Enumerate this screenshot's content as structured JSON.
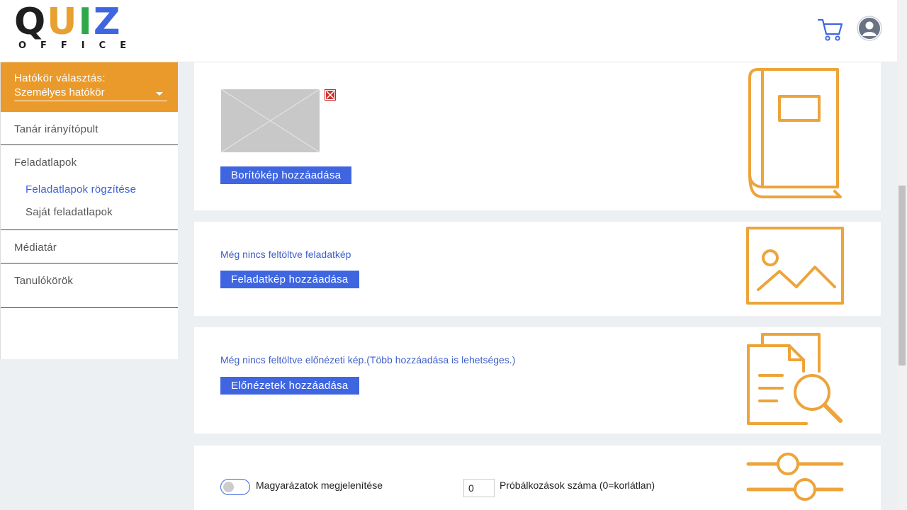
{
  "logo": {
    "line1": "QUIZ",
    "line2": "OFFICE"
  },
  "header": {
    "cart_icon": "cart-icon",
    "avatar_icon": "user-avatar-icon"
  },
  "sidebar": {
    "scope_label": "Hatókör választás:",
    "scope_value": "Személyes hatókör",
    "items": [
      {
        "label": "Tanár irányítópult"
      },
      {
        "label": "Feladatlapok",
        "children": [
          {
            "label": "Feladatlapok rögzítése",
            "active": true
          },
          {
            "label": "Saját feladatlapok"
          }
        ]
      },
      {
        "label": "Médiatár"
      },
      {
        "label": "Tanulókörök"
      }
    ]
  },
  "cover": {
    "button": "Borítókép hozzáadása"
  },
  "task_image": {
    "status": "Még nincs feltöltve feladatkép",
    "button": "Feladatkép hozzáadása"
  },
  "preview": {
    "status": "Még nincs feltöltve előnézeti kép.(Több hozzáadása is lehetséges.)",
    "button": "Előnézetek hozzáadása"
  },
  "settings": {
    "explanations_label": "Magyarázatok megjelenítése",
    "explanations_on": false,
    "attempts_value": "0",
    "attempts_label": "Próbálkozások száma (0=korlátlan)"
  },
  "colors": {
    "accent": "#ea9a2b",
    "primary": "#3f66e0",
    "link": "#3f5fc8"
  }
}
